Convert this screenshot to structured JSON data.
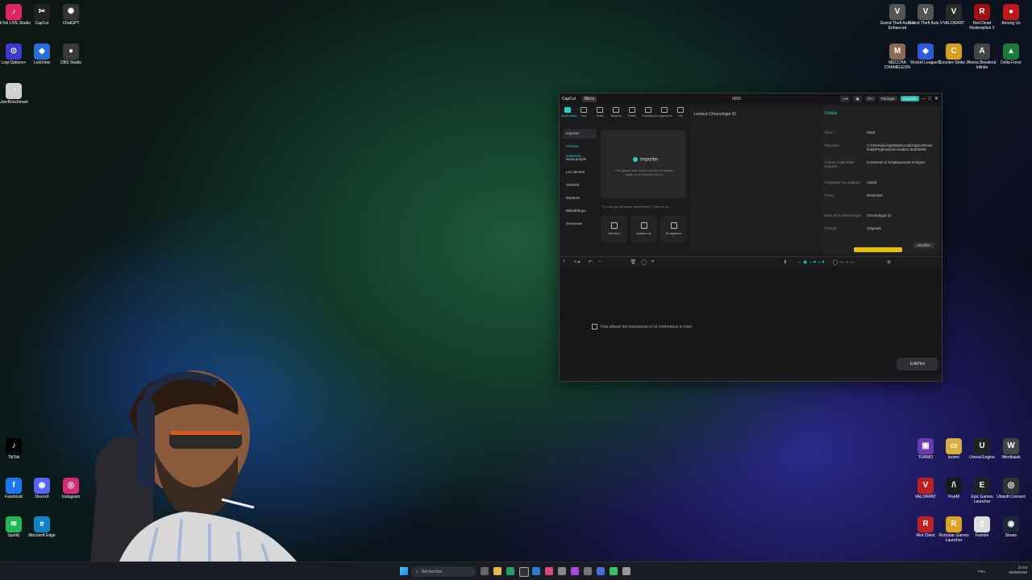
{
  "desktop_icons_left": [
    {
      "label": "TikTok LIVE Studio",
      "color": "#e0245e",
      "glyph": "♪"
    },
    {
      "label": "CapCut",
      "color": "#222222",
      "glyph": "✂"
    },
    {
      "label": "ChatGPT",
      "color": "#333333",
      "glyph": "✺"
    },
    {
      "label": "Logi Options+",
      "color": "#3b3bd1",
      "glyph": "⊙"
    },
    {
      "label": "LetsView",
      "color": "#2a6fd6",
      "glyph": "◆"
    },
    {
      "label": "OBS Studio",
      "color": "#3a3a3a",
      "glyph": "●"
    },
    {
      "label": "UserBenchmark",
      "color": "#d0d0d0",
      "glyph": "◔"
    }
  ],
  "desktop_icons_bottom_left": [
    {
      "label": "TikTok",
      "color": "#000000",
      "glyph": "♪"
    },
    {
      "label": "Facebook",
      "color": "#1877f2",
      "glyph": "f"
    },
    {
      "label": "Discord",
      "color": "#5865f2",
      "glyph": "◉"
    },
    {
      "label": "Instagram",
      "color": "#d62976",
      "glyph": "◎"
    },
    {
      "label": "Spotify",
      "color": "#1db954",
      "glyph": "≋"
    },
    {
      "label": "Microsoft Edge",
      "color": "#0a84c6",
      "glyph": "e"
    }
  ],
  "desktop_icons_top_right": [
    {
      "label": "Grand Theft Auto V Enhanced",
      "color": "#555555",
      "glyph": "V"
    },
    {
      "label": "Grand Theft Auto V",
      "color": "#555555",
      "glyph": "V"
    },
    {
      "label": "VALORANT",
      "color": "#2a2a2a",
      "glyph": "V"
    },
    {
      "label": "Red Dead Redemption 2",
      "color": "#a01010",
      "glyph": "R"
    },
    {
      "label": "Among Us",
      "color": "#c01818",
      "glyph": "●"
    },
    {
      "label": "MECCHA CHAMELEON",
      "color": "#8a6a55",
      "glyph": "M"
    },
    {
      "label": "Rocket League®",
      "color": "#2b5bd6",
      "glyph": "◈"
    },
    {
      "label": "Counter-Strike 2",
      "color": "#d8a020",
      "glyph": "C"
    },
    {
      "label": "Arena Breakout Infinite",
      "color": "#444444",
      "glyph": "A"
    },
    {
      "label": "Delta Force",
      "color": "#1a7a3a",
      "glyph": "▲"
    }
  ],
  "desktop_icons_bottom_right": [
    {
      "label": "TURMO",
      "color": "#6a3ab0",
      "glyph": "▣"
    },
    {
      "label": "tuomo",
      "color": "#d8b040",
      "glyph": "▭"
    },
    {
      "label": "Unreal Engine",
      "color": "#222222",
      "glyph": "U"
    },
    {
      "label": "Windhawk",
      "color": "#444444",
      "glyph": "W"
    },
    {
      "label": "VALORANT",
      "color": "#c02020",
      "glyph": "V"
    },
    {
      "label": "FiveM",
      "color": "#1a1a1a",
      "glyph": "/\\"
    },
    {
      "label": "Epic Games Launcher",
      "color": "#222222",
      "glyph": "E"
    },
    {
      "label": "Ubisoft Connect",
      "color": "#333333",
      "glyph": "◎"
    },
    {
      "label": "Riot Client",
      "color": "#c02020",
      "glyph": "R"
    },
    {
      "label": "Rockstar Games Launcher",
      "color": "#e0a020",
      "glyph": "R"
    },
    {
      "label": "Fortnite",
      "color": "#dddddd",
      "glyph": "▯"
    },
    {
      "label": "Steam",
      "color": "#1b2838",
      "glyph": "◉"
    }
  ],
  "capcut": {
    "logo": "CapCut",
    "menu": "Menu",
    "title": "0005",
    "pro": "Pro",
    "share": "Partager",
    "export": "Exporter",
    "toolbar": [
      "Multimédia",
      "Son",
      "Texte",
      "Stickers",
      "Effets",
      "Transitions",
      "Légendes",
      "Filt"
    ],
    "sidebar": [
      "Importer",
      "Fichiers multiméd...",
      "Sous-projets",
      "Les tiennes",
      "Général",
      "Espaces",
      "Bibliothèque",
      "Dreamina"
    ],
    "import_title": "Importer",
    "import_sub": "Fais glisser des vidéos, photos et fichiers audio ici ou importe-les ici",
    "hint": "Tu n'as pas de fichier multimédia ? Crée-en un...",
    "cards": [
      "Générer",
      "Avatars IA",
      "Enregistrer"
    ],
    "player_title": "Lecteur-Chronologie 01",
    "details_title": "Détails",
    "details": [
      {
        "k": "Nom :",
        "v": "0005"
      },
      {
        "k": "Parcours :",
        "v": "C:/Users/pc/AppData/Local/CapCut/User Data/Projects/com.lveditor.draft/0005"
      },
      {
        "k": "Fichier multimédia importé :",
        "v": "Conserver à l'emplacement d'origine"
      },
      {
        "k": "Organiser les calques :",
        "v": "Activé"
      },
      {
        "k": "Proxy :",
        "v": "Désactivé"
      },
      {
        "k": "Nom de la chronologie :",
        "v": "Chronologie 01"
      },
      {
        "k": "Format :",
        "v": "Originale"
      }
    ],
    "modify": "Modifier",
    "timeline_hint": "Fais glisser les ressources ici et commence à créer",
    "editpilot": "EditPilot"
  },
  "taskbar": {
    "search_placeholder": "Rechercher",
    "lang": "FRA",
    "time": "22:53",
    "date": "05/08/2026"
  }
}
